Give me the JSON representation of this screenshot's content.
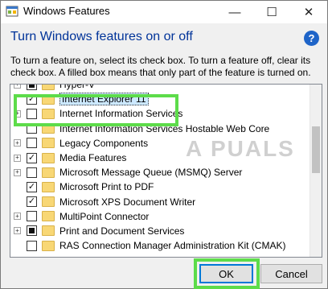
{
  "window": {
    "title": "Windows Features",
    "minimize_glyph": "—",
    "maximize_glyph": "☐",
    "close_glyph": "✕"
  },
  "heading": "Turn Windows features on or off",
  "help_glyph": "?",
  "description": "To turn a feature on, select its check box. To turn a feature off, clear its check box. A filled box means that only part of the feature is turned on.",
  "watermark": "A PUALS",
  "features": [
    {
      "label": "Hyper-V",
      "expander": "+",
      "state": "partial"
    },
    {
      "label": "Internet Explorer 11",
      "expander": "",
      "state": "checked",
      "selected": true
    },
    {
      "label": "Internet Information Services",
      "expander": "+",
      "state": "unchecked"
    },
    {
      "label": "Internet Information Services Hostable Web Core",
      "expander": "",
      "state": "unchecked"
    },
    {
      "label": "Legacy Components",
      "expander": "+",
      "state": "unchecked"
    },
    {
      "label": "Media Features",
      "expander": "+",
      "state": "checked"
    },
    {
      "label": "Microsoft Message Queue (MSMQ) Server",
      "expander": "+",
      "state": "unchecked"
    },
    {
      "label": "Microsoft Print to PDF",
      "expander": "",
      "state": "checked"
    },
    {
      "label": "Microsoft XPS Document Writer",
      "expander": "",
      "state": "checked"
    },
    {
      "label": "MultiPoint Connector",
      "expander": "+",
      "state": "unchecked"
    },
    {
      "label": "Print and Document Services",
      "expander": "+",
      "state": "partial"
    },
    {
      "label": "RAS Connection Manager Administration Kit (CMAK)",
      "expander": "",
      "state": "unchecked"
    }
  ],
  "buttons": {
    "ok": "OK",
    "cancel": "Cancel"
  },
  "colors": {
    "heading": "#003399",
    "highlight": "#5ddc4a",
    "folder": "#f8d775"
  }
}
